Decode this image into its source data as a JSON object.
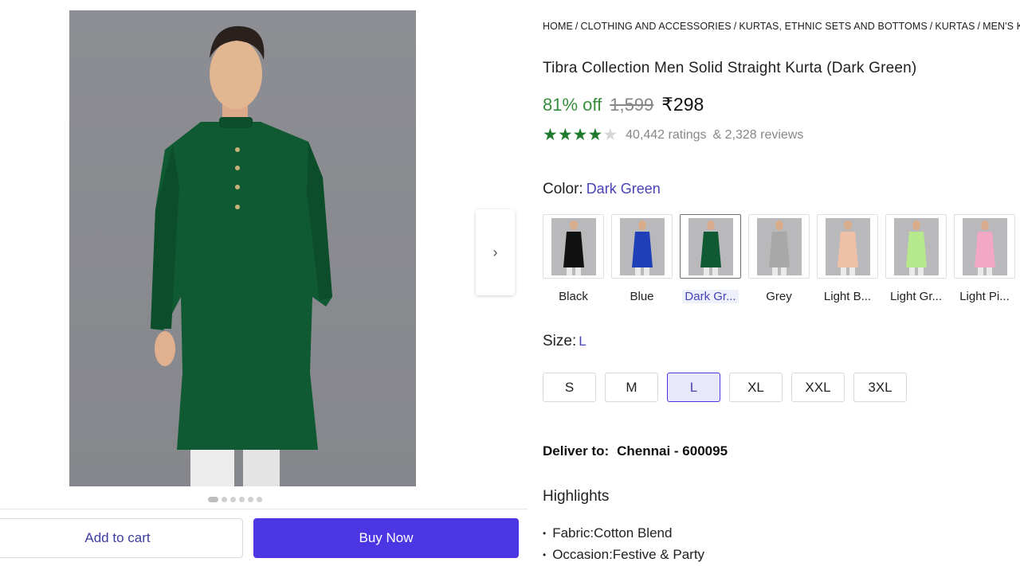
{
  "breadcrumb": [
    "HOME",
    "CLOTHING AND ACCESSORIES",
    "KURTAS, ETHNIC SETS AND BOTTOMS",
    "KURTAS",
    "MEN'S KURTAS"
  ],
  "product": {
    "title": "Tibra Collection Men Solid Straight Kurta (Dark Green)",
    "discount": "81% off",
    "mrp": "1,599",
    "price": "₹298",
    "rating_value": 4,
    "ratings": "40,442 ratings",
    "reviews": "& 2,328 reviews"
  },
  "color": {
    "label": "Color:",
    "selected": "Dark Green",
    "options": [
      {
        "label": "Black",
        "hex": "#111111"
      },
      {
        "label": "Blue",
        "hex": "#1f3fb8"
      },
      {
        "label": "Dark Gr...",
        "hex": "#0f5a32"
      },
      {
        "label": "Grey",
        "hex": "#a8a8a8"
      },
      {
        "label": "Light B...",
        "hex": "#efc0a8"
      },
      {
        "label": "Light Gr...",
        "hex": "#b6e98b"
      },
      {
        "label": "Light Pi...",
        "hex": "#f2a8c4"
      }
    ]
  },
  "size": {
    "label": "Size:",
    "selected": "L",
    "options": [
      "S",
      "M",
      "L",
      "XL",
      "XXL",
      "3XL"
    ]
  },
  "delivery": {
    "label": "Deliver to:",
    "location": "Chennai - 600095"
  },
  "highlights": {
    "title": "Highlights",
    "items": [
      "Fabric:Cotton Blend",
      "Occasion:Festive & Party"
    ]
  },
  "actions": {
    "add_to_cart": "Add to cart",
    "buy_now": "Buy Now"
  },
  "carousel": {
    "total": 6,
    "active": 1
  },
  "colors": {
    "accent": "#4c36e4",
    "discount_green": "#388e3c",
    "star_green": "#1f7a2e",
    "kurta_green": "#0f5a32"
  }
}
